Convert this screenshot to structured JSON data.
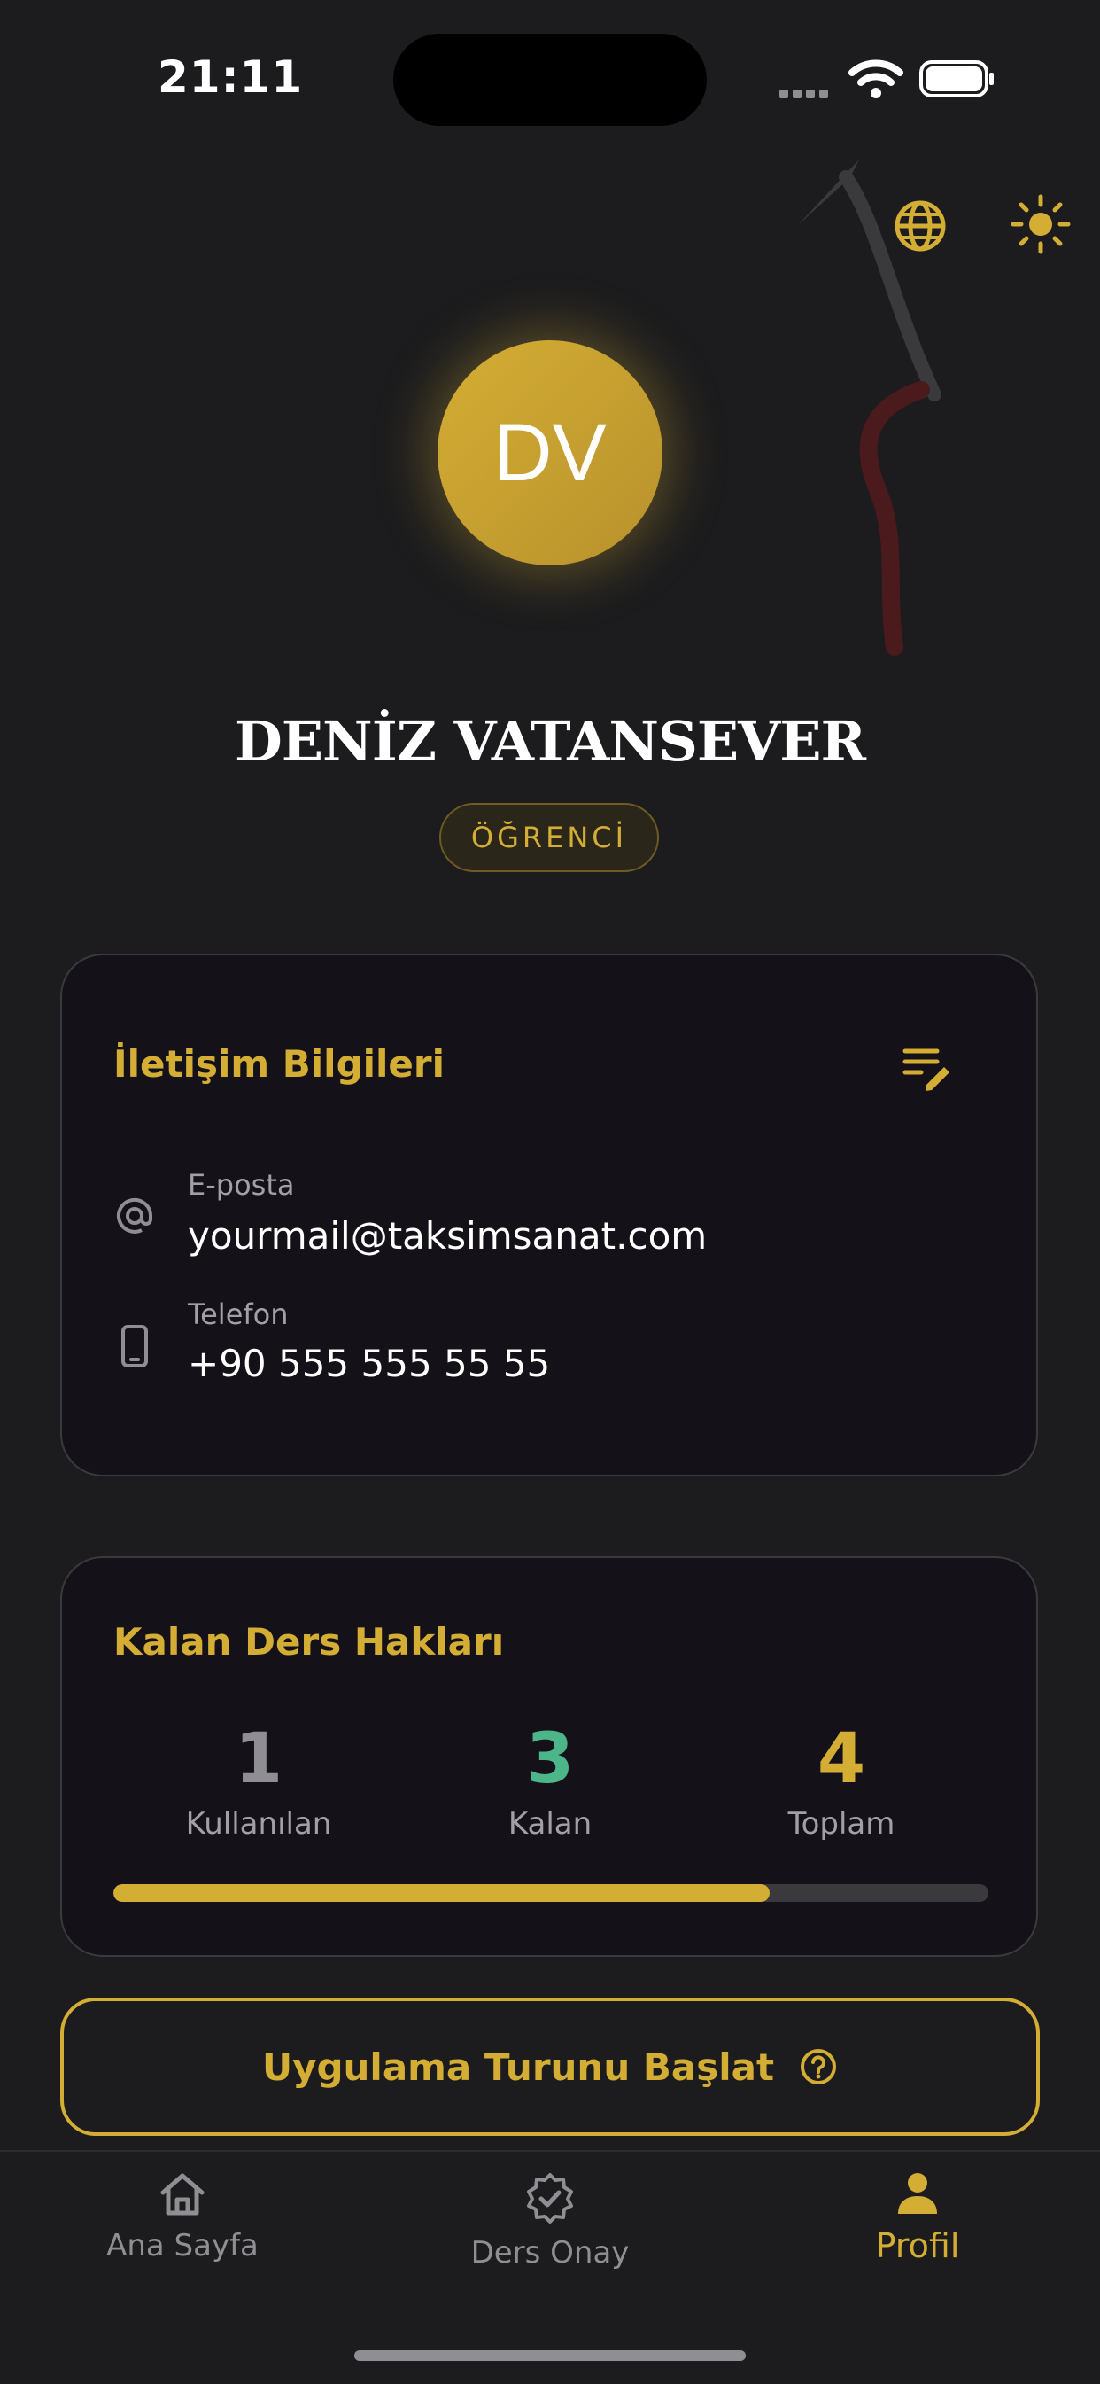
{
  "status_bar": {
    "time": "21:11"
  },
  "profile": {
    "initials": "DV",
    "name": "DENİZ VATANSEVER",
    "role": "ÖĞRENCİ"
  },
  "contact_card": {
    "title": "İletişim Bilgileri",
    "email_label": "E-posta",
    "email_value": "yourmail@taksimsanat.com",
    "phone_label": "Telefon",
    "phone_value": "+90 555 555 55 55"
  },
  "lessons_card": {
    "title": "Kalan Ders Hakları",
    "used_value": "1",
    "used_label": "Kullanılan",
    "remaining_value": "3",
    "remaining_label": "Kalan",
    "total_value": "4",
    "total_label": "Toplam",
    "progress_fraction": 0.75
  },
  "tour_button": {
    "label": "Uygulama Turunu Başlat"
  },
  "tab_bar": {
    "items": [
      {
        "label": "Ana Sayfa",
        "icon": "home-icon"
      },
      {
        "label": "Ders Onay",
        "icon": "badge-check-icon"
      },
      {
        "label": "Profil",
        "icon": "person-icon",
        "active": true
      }
    ]
  },
  "colors": {
    "accent": "#d4ad34",
    "remaining_green": "#4cb58a",
    "background": "#1c1c1e",
    "card": "#141218"
  }
}
